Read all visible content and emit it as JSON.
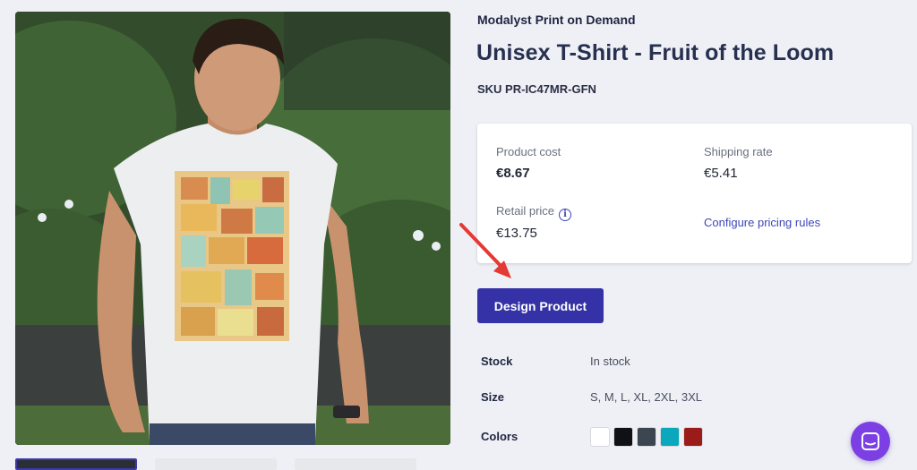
{
  "product": {
    "brand": "Modalyst Print on Demand",
    "title": "Unisex T-Shirt - Fruit of the Loom",
    "sku": "SKU PR-IC47MR-GFN"
  },
  "pricing": {
    "product_cost_label": "Product cost",
    "product_cost_value": "€8.67",
    "shipping_rate_label": "Shipping rate",
    "shipping_rate_value": "€5.41",
    "retail_price_label": "Retail price",
    "retail_price_value": "€13.75",
    "info_icon": "i",
    "configure_link": "Configure pricing rules"
  },
  "actions": {
    "design_button": "Design Product"
  },
  "details": {
    "stock_label": "Stock",
    "stock_value": "In stock",
    "size_label": "Size",
    "size_value": "S, M, L, XL, 2XL, 3XL",
    "colors_label": "Colors",
    "colors": [
      "#ffffff",
      "#0f1115",
      "#3b4650",
      "#0aa7bd",
      "#9b1b1b"
    ]
  },
  "theme": {
    "accent": "#3432a6",
    "link": "#3d47b8",
    "annotation_arrow": "#e53935",
    "chat_launcher": "#7b3fe4"
  },
  "icons": {
    "info": "info-icon",
    "chat": "chat-icon",
    "annotation": "red-arrow-icon"
  }
}
